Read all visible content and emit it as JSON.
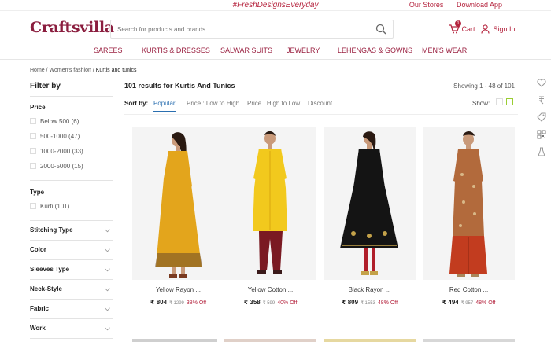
{
  "topbar": {
    "tagline": "#FreshDesignsEveryday",
    "links": [
      "Our Stores",
      "Download App"
    ]
  },
  "header": {
    "logo": "Craftsvilla",
    "search_placeholder": "Search for products and brands",
    "cart_label": "Cart",
    "cart_count": "1",
    "signin_label": "Sign In"
  },
  "nav": [
    "SAREES",
    "KURTIS & DRESSES",
    "SALWAR SUITS",
    "JEWELRY",
    "LEHENGAS & GOWNS",
    "MEN'S WEAR"
  ],
  "breadcrumb": {
    "home": "Home",
    "sep": " / ",
    "cat": "Women's fashion",
    "current": "Kurtis and tunics"
  },
  "filters": {
    "title": "Filter by",
    "price": {
      "title": "Price",
      "options": [
        "Below 500 (6)",
        "500-1000 (47)",
        "1000-2000 (33)",
        "2000-5000 (15)"
      ]
    },
    "type": {
      "title": "Type",
      "options": [
        "Kurti (101)"
      ]
    },
    "accordions": [
      "Stitching Type",
      "Color",
      "Sleeves Type",
      "Neck-Style",
      "Fabric",
      "Work"
    ]
  },
  "results": {
    "text": "101 results for  Kurtis And Tunics",
    "showing": "Showing   1 - 48 of 101"
  },
  "sort": {
    "label": "Sort by:",
    "options": [
      "Popular",
      "Price : Low to High",
      "Price : High to Low",
      "Discount"
    ],
    "active": "Popular",
    "show_label": "Show:"
  },
  "products": [
    {
      "name": "Yellow Rayon ...",
      "price": "₹ 804",
      "mrp": "₹ 1299",
      "off": "38% Off",
      "dress": "#e3a51c",
      "trim": "#6b4a2a"
    },
    {
      "name": "Yellow Cotton ...",
      "price": "₹ 358",
      "mrp": "₹ 599",
      "off": "40% Off",
      "dress": "#f2c91d",
      "trim": "#7a1a22"
    },
    {
      "name": "Black Rayon ...",
      "price": "₹ 809",
      "mrp": "₹ 1553",
      "off": "48% Off",
      "dress": "#141414",
      "trim": "#c4a24a"
    },
    {
      "name": "Red Cotton ...",
      "price": "₹ 494",
      "mrp": "₹ 957",
      "off": "48% Off",
      "dress": "#b26a3c",
      "trim": "#c23c1f"
    }
  ],
  "colors": {
    "brand": "#8b1e3f",
    "accent": "#b5243e",
    "link": "#2a6fb0"
  }
}
